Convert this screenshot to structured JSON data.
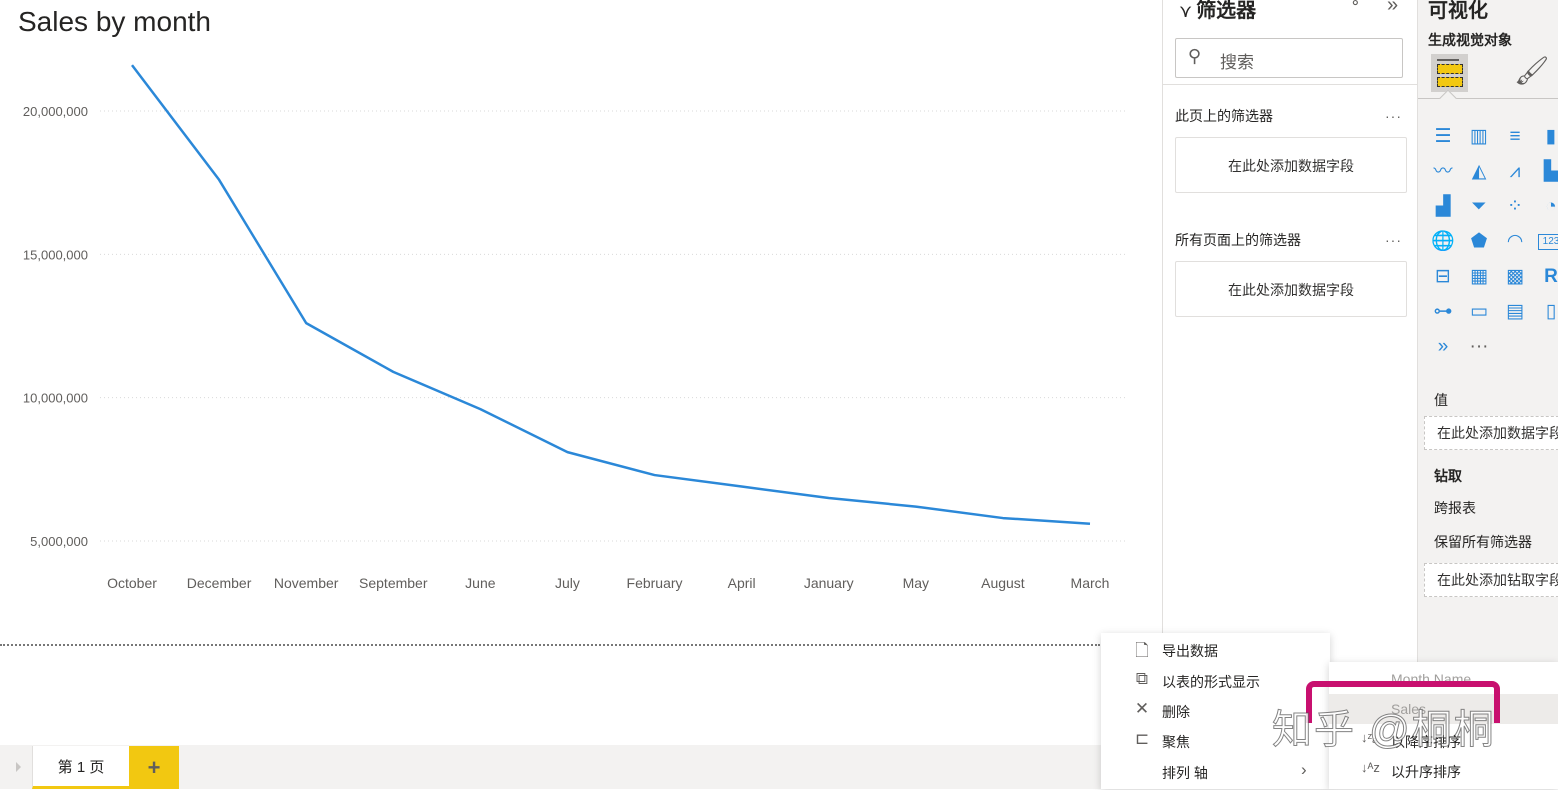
{
  "chart_data": {
    "type": "line",
    "title": "Sales by month",
    "xlabel": "",
    "ylabel": "",
    "categories": [
      "October",
      "December",
      "November",
      "September",
      "June",
      "July",
      "February",
      "April",
      "January",
      "May",
      "August",
      "March"
    ],
    "series": [
      {
        "name": "Sales",
        "color": "#2b88d8",
        "values": [
          21600000,
          17600000,
          12600000,
          10900000,
          9600000,
          8100000,
          7300000,
          6900000,
          6500000,
          6200000,
          5800000,
          5600000
        ]
      }
    ],
    "yticks": [
      5000000,
      10000000,
      15000000,
      20000000
    ],
    "ytick_labels": [
      "5,000,000",
      "10,000,000",
      "15,000,000",
      "20,000,000"
    ],
    "ylim": [
      3500000,
      22500000
    ],
    "grid": true,
    "legend": "none"
  },
  "pages": {
    "tabs": [
      {
        "label": "第 1 页",
        "active": true
      }
    ],
    "add_label": "+"
  },
  "filters": {
    "title": "筛选器",
    "eye_icon": "visibility-icon",
    "collapse_icon": "»",
    "search_placeholder": "搜索",
    "this_page_label": "此页上的筛选器",
    "this_page_well": "在此处添加数据字段",
    "all_pages_label": "所有页面上的筛选器",
    "all_pages_well": "在此处添加数据字段",
    "more": "···"
  },
  "visualizations": {
    "title": "可视化",
    "subtitle": "生成视觉对象",
    "values_label": "值",
    "values_well": "在此处添加数据字段",
    "drillthrough_label": "钻取",
    "cross_report_label": "跨报表",
    "keep_filters_label": "保留所有筛选器",
    "drill_well": "在此处添加钻取字段",
    "more": "···",
    "icons": [
      "stacked-bar-icon",
      "stacked-column-icon",
      "clustered-bar-icon",
      "clustered-column-icon",
      "line-chart-icon",
      "area-chart-icon",
      "stacked-area-icon",
      "line-column-icon",
      "ribbon-chart-icon",
      "funnel-icon",
      "scatter-icon",
      "pie-chart-icon",
      "globe-map-icon",
      "filled-map-icon",
      "gauge-icon",
      "card-icon",
      "slicer-icon",
      "table-icon",
      "matrix-icon",
      "r-visual-icon",
      "decomposition-tree-icon",
      "qa-icon",
      "smart-narrative-icon",
      "paginated-report-icon",
      "power-automate-icon",
      "more-visuals-icon"
    ],
    "icon_glyphs": [
      "☰",
      "▥",
      "≡",
      "▮",
      "〰",
      "◭",
      "⩘",
      "▙",
      "▟",
      "⏷",
      "⁘",
      "◔",
      "🌐",
      "⬟",
      "◠",
      "123",
      "⊟",
      "▦",
      "▩",
      "R",
      "⊶",
      "▭",
      "▤",
      "▯",
      "»",
      "···"
    ]
  },
  "context_menu": {
    "items": [
      {
        "label": "导出数据",
        "icon": "🗋"
      },
      {
        "label": "以表的形式显示",
        "icon": "⧉"
      },
      {
        "label": "删除",
        "icon": "✕"
      },
      {
        "label": "聚焦",
        "icon": "⊏"
      },
      {
        "label": "排列 轴",
        "icon": "",
        "submenu_arrow": "›"
      }
    ]
  },
  "sort_submenu": {
    "fields": [
      {
        "label": "Month Name",
        "selected": false
      },
      {
        "label": "Sales",
        "selected": true
      }
    ],
    "actions": [
      {
        "label": "以降序排序",
        "icon": "↓Z/A"
      },
      {
        "label": "以升序排序",
        "icon": "↓A/Z"
      }
    ]
  },
  "watermark": "知乎 @桐桐"
}
